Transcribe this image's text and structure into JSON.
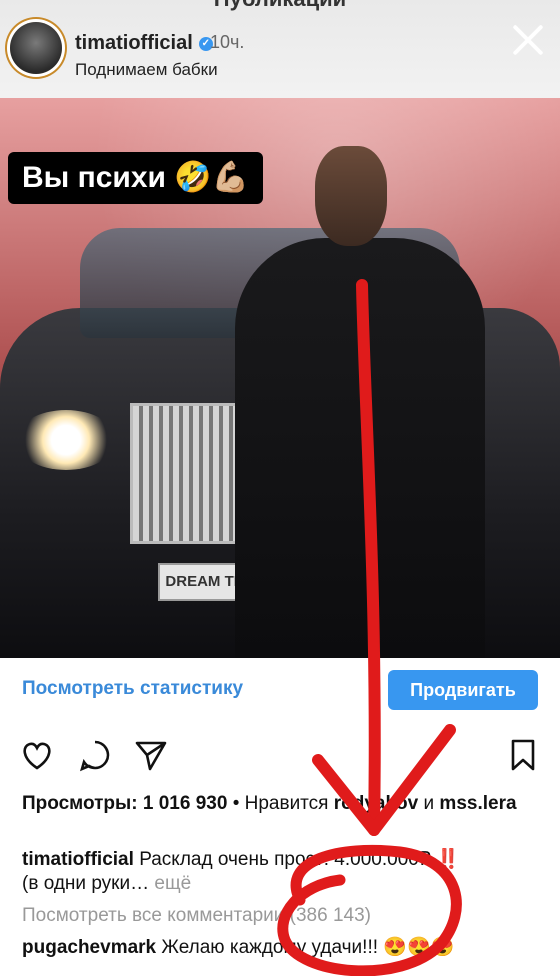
{
  "top_title": "Публикации",
  "header": {
    "username": "timatiofficial",
    "time": "10ч.",
    "subtitle": "Поднимаем бабки"
  },
  "photo": {
    "caption_overlay": "Вы психи 🤣💪🏼",
    "plate_text": "DREAM TEA"
  },
  "actions": {
    "stats_link": "Посмотреть статистику",
    "promote_button": "Продвигать"
  },
  "views_line": {
    "views": "Просмотры: 1 016 930",
    "likes_text": "• Нравится",
    "like_users": "rodyakov",
    "and": "и",
    "like_user2": "mss.lera"
  },
  "caption": {
    "username": "timatiofficial",
    "text": "Расклад очень прост: 4.000.000₽",
    "emoji": "‼️",
    "text2": "(в одни руки…",
    "more": "ещё"
  },
  "comments_link": "Посмотреть все комментарии (386 143)",
  "comment": {
    "username": "pugachevmark",
    "text": "Желаю каждому удачи!!! 😍😍😍"
  },
  "colors": {
    "accent": "#3897f0",
    "annotation": "#e01b1b"
  }
}
